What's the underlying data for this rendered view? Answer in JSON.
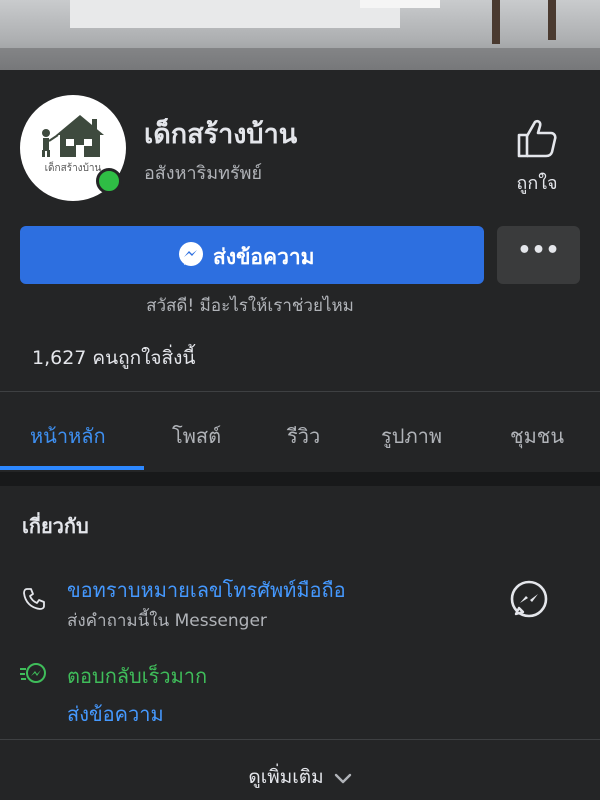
{
  "page": {
    "name": "เด็กสร้างบ้าน",
    "category": "อสังหาริมทรัพย์",
    "avatar_text": "เด็กสร้างบ้าน",
    "like_label": "ถูกใจ",
    "message_button": "ส่งข้อความ",
    "more_button": "•••",
    "greeting": "สวัสดี! มีอะไรให้เราช่วยไหม",
    "likes_count": "1,627 คนถูกใจสิ่งนี้"
  },
  "tabs": [
    {
      "label": "หน้าหลัก",
      "active": true
    },
    {
      "label": "โพสต์",
      "active": false
    },
    {
      "label": "รีวิว",
      "active": false
    },
    {
      "label": "รูปภาพ",
      "active": false
    },
    {
      "label": "ชุมชน",
      "active": false
    }
  ],
  "about": {
    "title": "เกี่ยวกับ",
    "phone_link": "ขอทราบหมายเลขโทรศัพท์มือถือ",
    "phone_sub": "ส่งคำถามนี้ใน Messenger",
    "response": "ตอบกลับเร็วมาก",
    "send_message": "ส่งข้อความ",
    "see_more": "ดูเพิ่มเติม"
  },
  "colors": {
    "background": "#242526",
    "accent_blue": "#2d6fe0",
    "link_blue": "#4599ff",
    "online_green": "#2fbd45",
    "response_green": "#3fbd5a"
  },
  "icons": [
    "house-logo-icon",
    "thumbs-up-icon",
    "messenger-icon",
    "more-icon",
    "phone-icon",
    "messenger-circle-icon",
    "fast-response-icon",
    "chevron-down-icon"
  ]
}
